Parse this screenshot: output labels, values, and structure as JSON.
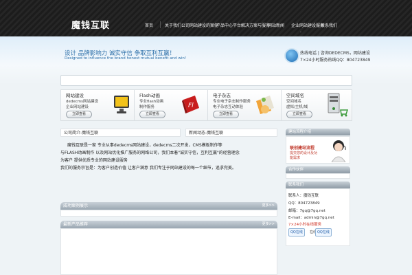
{
  "header": {
    "logo": "魔钱互联",
    "nav": [
      "首页",
      "关于我们公司",
      "网站建设的案例",
      "产品中心平台",
      "解决方案与服务",
      "网站新闻",
      "企业网站建设服务",
      "联系我们"
    ]
  },
  "banner": {
    "slogan_cn": "设计 品牌影响力    诚实守信 争取互利互赢！",
    "slogan_en": "Designed to influence the brand honest mutual benefit and win!",
    "hotline_1": "热线电话 | 咨询DEDECMS，网站建设",
    "hotline_2": "7×24小时服务热线QQ：804723849"
  },
  "services": [
    {
      "title": "网站建设",
      "line1": "dedecms网站建设",
      "line2": "企业网站建设",
      "btn": "立即查看"
    },
    {
      "title": "Flash动画",
      "line1": "专业flash动画",
      "line2": "制作服务",
      "btn": "立即查看"
    },
    {
      "title": "电子杂志",
      "line1": "专业电子杂志制作服务",
      "line2": "电子杂志互动体验",
      "btn": "立即查看"
    },
    {
      "title": "空间域名",
      "line1": "空间域名",
      "line2": "虚拟/主机/域",
      "btn": "立即查看"
    }
  ],
  "content": {
    "head_left": "公司简介-魔钱互联",
    "head_right": "新闻动态-魔钱互联",
    "intro": [
      "魔钱互联是一家 专业从事dedecms网站建设，dedecms二次开发，CMS模板制作等",
      "与FLASH动画制作 以及网站优化推广服务的网络公司，我们本着\"诚实守信，互利互赢\"的经营理念",
      "为客户 提供优质专业的网站建设服务",
      "我们的服务宗旨是：为客户创造价值 让客户满意 我们专注于网站建设的每一个细节，追求完美。"
    ],
    "bar1_title": "成功案例展示",
    "bar1_more": "更多>>",
    "bar2_title": "最新产品推荐",
    "bar2_more": "更多>>"
  },
  "sidebar": {
    "head1": "建站流程介绍",
    "flow_title": "联创建站流程",
    "flow_sub": "提交您的设计及功能需求",
    "head2": "合作伙伴",
    "head3": "联系我们",
    "contact": [
      "联系人：魔钱互联",
      "QQ：804723849",
      "邮箱：7gq@7gq.net",
      "E-mail：admin@7gq.net"
    ],
    "service_note": "7×24小时在线服务",
    "qq1": "QQ在线",
    "qq_sep": "在线",
    "qq2": "QQ在线"
  }
}
